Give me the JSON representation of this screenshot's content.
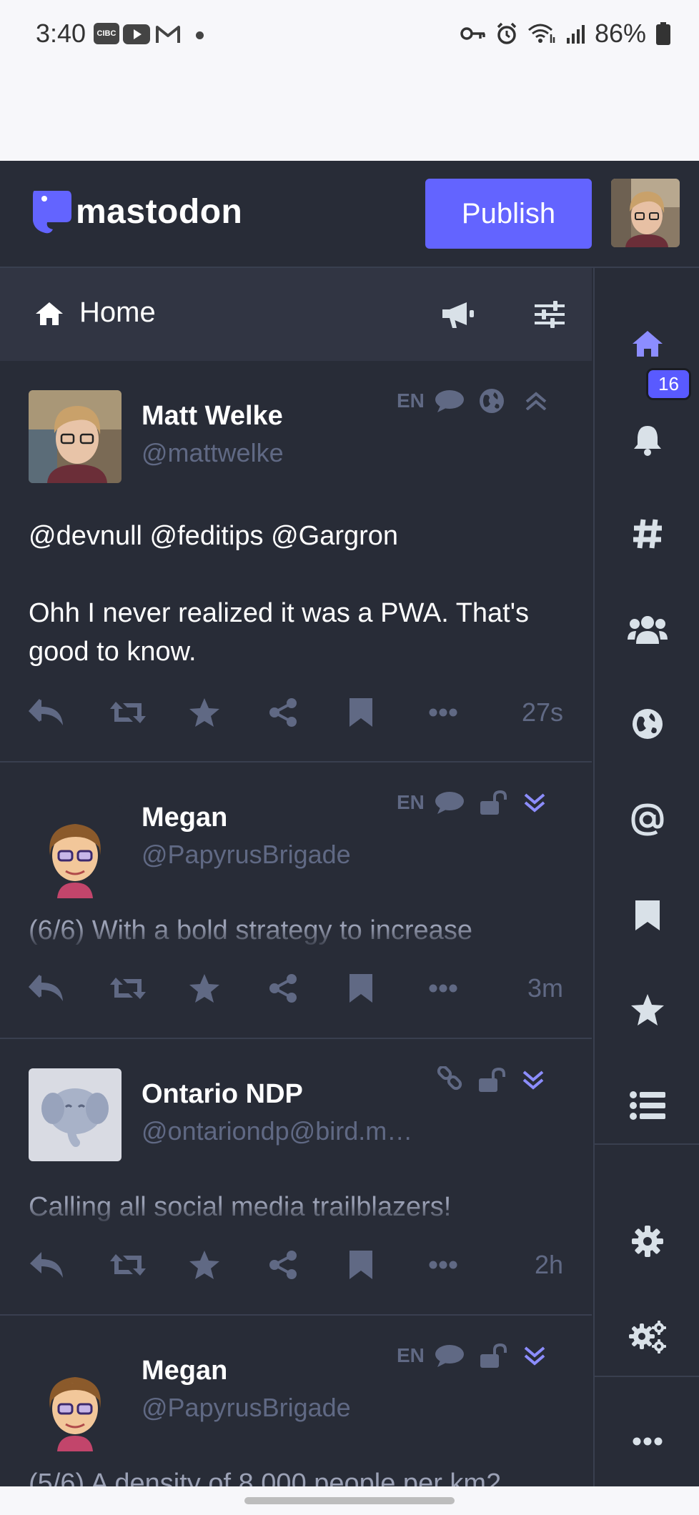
{
  "status_bar": {
    "time": "3:40",
    "app_icons": [
      "CIBC",
      "youtube-icon",
      "gmail-icon"
    ],
    "battery": "86%"
  },
  "header": {
    "logo_text": "mastodon",
    "publish_label": "Publish"
  },
  "column": {
    "title": "Home"
  },
  "posts": [
    {
      "name": "Matt Welke",
      "handle": "@mattwelke",
      "lang": "EN",
      "content_lines": [
        "@devnull @feditips @Gargron",
        "",
        "Ohh I never realized it was a PWA. That's",
        "good to know."
      ],
      "time": "27s",
      "visibility": "public"
    },
    {
      "name": "Megan",
      "handle": "@PapyrusBrigade",
      "lang": "EN",
      "content": "(6/6) With a bold strategy to increase",
      "time": "3m",
      "visibility": "unlisted"
    },
    {
      "name": "Ontario NDP",
      "handle": "@ontariondp@bird.m…",
      "content": "Calling all social media trailblazers!",
      "time": "2h",
      "visibility": "unlisted"
    },
    {
      "name": "Megan",
      "handle": "@PapyrusBrigade",
      "lang": "EN",
      "content": "(5/6) A density of 8,000 people per km2"
    }
  ],
  "nav": {
    "notifications_badge": "16",
    "active": "home"
  },
  "colors": {
    "accent": "#6364ff",
    "background": "#282c37",
    "muted": "#606984",
    "nav_icon": "#d9e1e8"
  }
}
